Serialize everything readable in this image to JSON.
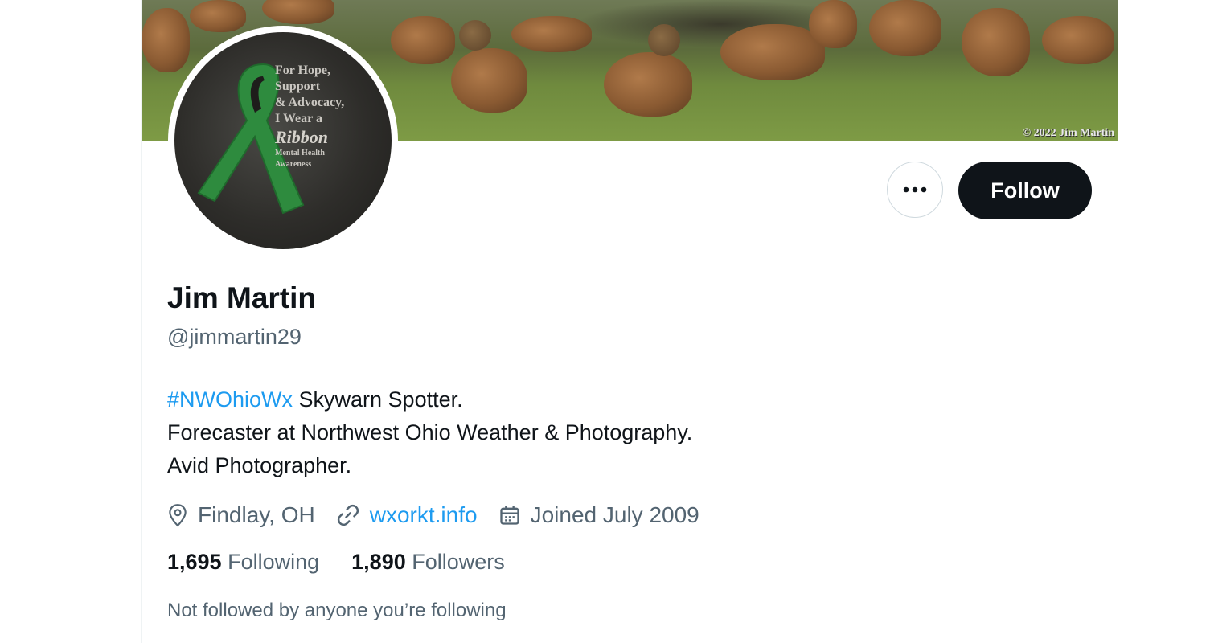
{
  "banner": {
    "watermark": "© 2022 Jim Martin"
  },
  "avatar": {
    "lines": [
      "For Hope,",
      "Support",
      "& Advocacy,",
      "I Wear a"
    ],
    "script": "Ribbon",
    "small_1": "Mental Health",
    "small_2": "Awareness",
    "ribbon_color": "#2e8b3e"
  },
  "actions": {
    "more_icon": "more-horizontal-icon",
    "follow_label": "Follow"
  },
  "profile": {
    "name": "Jim Martin",
    "handle": "@jimmartin29",
    "bio": {
      "hashtag": "#NWOhioWx",
      "line1_rest": " Skywarn Spotter.",
      "line2": "Forecaster at Northwest Ohio Weather & Photography.",
      "line3": "Avid Photographer."
    },
    "location": "Findlay, OH",
    "website": "wxorkt.info",
    "joined": "Joined July 2009",
    "following_count": "1,695",
    "following_label": "Following",
    "followers_count": "1,890",
    "followers_label": "Followers",
    "not_followed_text": "Not followed by anyone you’re following"
  },
  "colors": {
    "accent": "#1d9bf0",
    "primary_text": "#0f1419",
    "secondary_text": "#536471",
    "button_dark": "#0f1419"
  }
}
